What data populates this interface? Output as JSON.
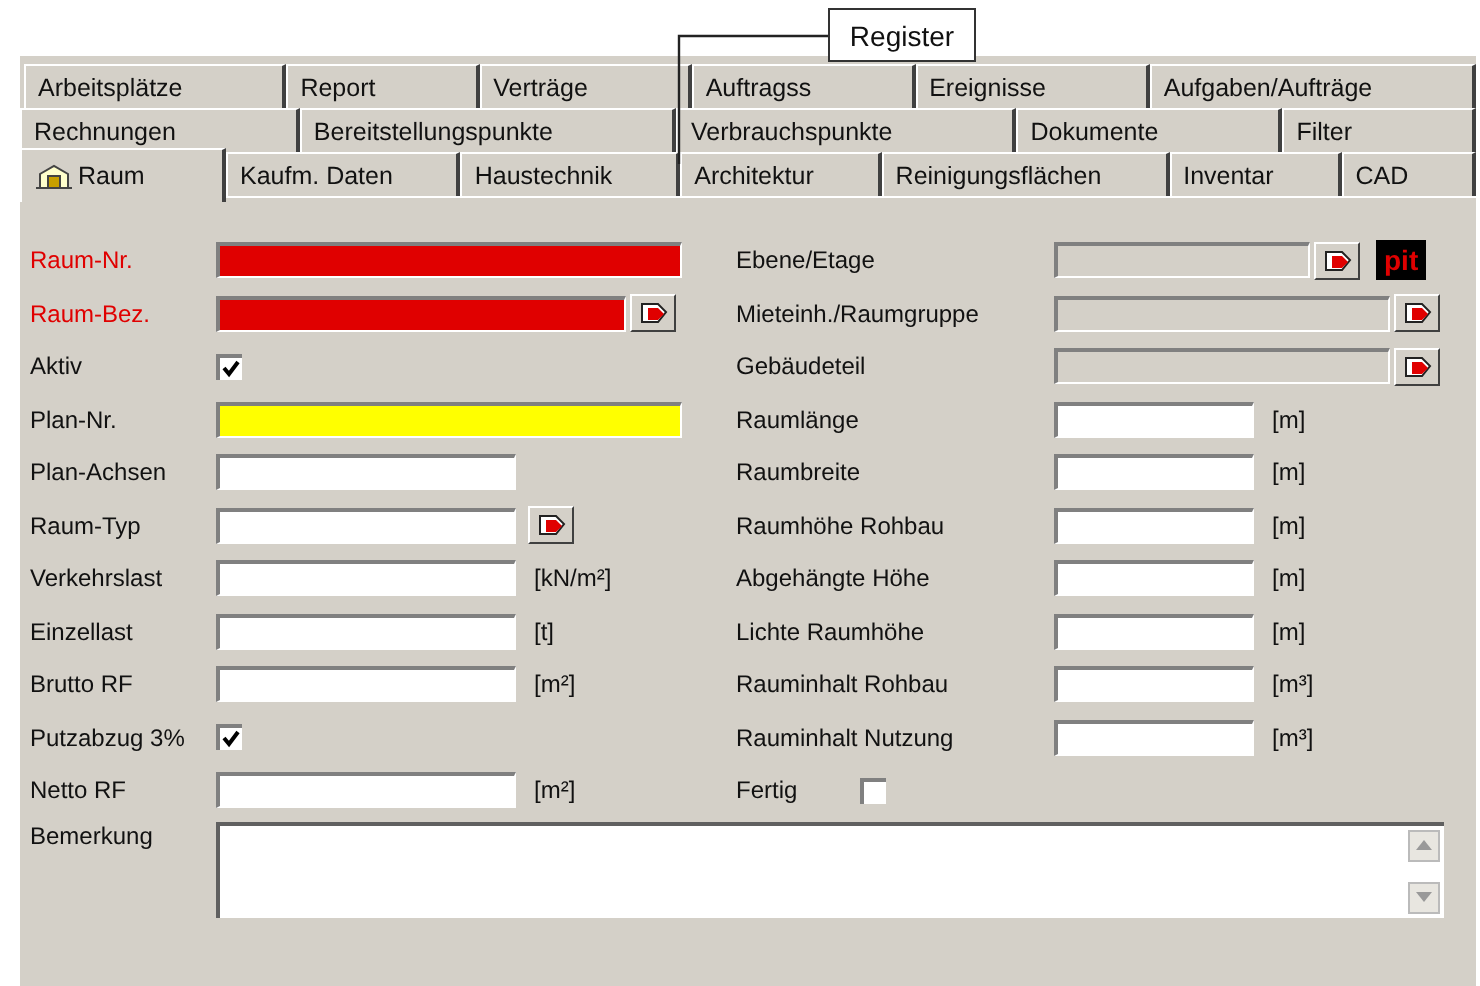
{
  "callout": {
    "text": "Register"
  },
  "tab_rows": [
    [
      {
        "label": "Arbeitsplätze",
        "selected": false
      },
      {
        "label": "Report",
        "selected": false
      },
      {
        "label": "Verträge",
        "selected": false
      },
      {
        "label": "Auftragss",
        "selected": false
      },
      {
        "label": "Ereignisse",
        "selected": false
      },
      {
        "label": "Aufgaben/Aufträge",
        "selected": false
      }
    ],
    [
      {
        "label": "Rechnungen",
        "selected": false
      },
      {
        "label": "Bereitstellungspunkte",
        "selected": false
      },
      {
        "label": "Verbrauchspunkte",
        "selected": false
      },
      {
        "label": "Dokumente",
        "selected": false
      },
      {
        "label": "Filter",
        "selected": false
      }
    ],
    [
      {
        "label": "Raum",
        "selected": true
      },
      {
        "label": "Kaufm. Daten",
        "selected": false
      },
      {
        "label": "Haustechnik",
        "selected": false
      },
      {
        "label": "Architektur",
        "selected": false
      },
      {
        "label": "Reinigungsflächen",
        "selected": false
      },
      {
        "label": "Inventar",
        "selected": false
      },
      {
        "label": "CAD",
        "selected": false
      }
    ]
  ],
  "left_fields": [
    {
      "label": "Raum-Nr.",
      "kind": "wide",
      "required": true,
      "color": "#e00000"
    },
    {
      "label": "Raum-Bez.",
      "kind": "wide-lookup",
      "required": true,
      "color": "#e00000"
    },
    {
      "label": "Aktiv",
      "kind": "check",
      "checked": true
    },
    {
      "label": "Plan-Nr.",
      "kind": "wide",
      "required": false,
      "color": "#ffff00"
    },
    {
      "label": "Plan-Achsen",
      "kind": "short",
      "required": false,
      "color": "#ffffff"
    },
    {
      "label": "Raum-Typ",
      "kind": "short-lookup",
      "required": false,
      "color": "#ffffff"
    },
    {
      "label": "Verkehrslast",
      "kind": "short",
      "required": false,
      "color": "#ffffff",
      "unit": "[kN/m²]"
    },
    {
      "label": "Einzellast",
      "kind": "short",
      "required": false,
      "color": "#ffffff",
      "unit": "[t]"
    },
    {
      "label": "Brutto RF",
      "kind": "short",
      "required": false,
      "color": "#ffffff",
      "unit": "[m²]"
    },
    {
      "label": "Putzabzug 3%",
      "kind": "check",
      "checked": true
    },
    {
      "label": "Netto RF",
      "kind": "short",
      "required": false,
      "color": "#ffffff",
      "unit": "[m²]"
    }
  ],
  "right_fields": [
    {
      "label": "Ebene/Etage",
      "kind": "wide-lookup",
      "disabled": true,
      "badge": "pit"
    },
    {
      "label": "Mieteinh./Raumgruppe",
      "kind": "wide-lookup",
      "disabled": true
    },
    {
      "label": "Gebäudeteil",
      "kind": "wide-lookup",
      "disabled": true
    },
    {
      "label": "Raumlänge",
      "kind": "short",
      "disabled": false,
      "unit": "[m]"
    },
    {
      "label": "Raumbreite",
      "kind": "short",
      "disabled": false,
      "unit": "[m]"
    },
    {
      "label": "Raumhöhe Rohbau",
      "kind": "short",
      "disabled": false,
      "unit": "[m]"
    },
    {
      "label": "Abgehängte Höhe",
      "kind": "short",
      "disabled": false,
      "unit": "[m]"
    },
    {
      "label": "Lichte Raumhöhe",
      "kind": "short",
      "disabled": false,
      "unit": "[m]"
    },
    {
      "label": "Rauminhalt Rohbau",
      "kind": "short",
      "disabled": false,
      "unit": "[m³]"
    },
    {
      "label": "Rauminhalt Nutzung",
      "kind": "short",
      "disabled": false,
      "unit": "[m³]"
    },
    {
      "label": "Fertig",
      "kind": "check",
      "checked": false
    }
  ],
  "remark": {
    "label": "Bemerkung"
  }
}
